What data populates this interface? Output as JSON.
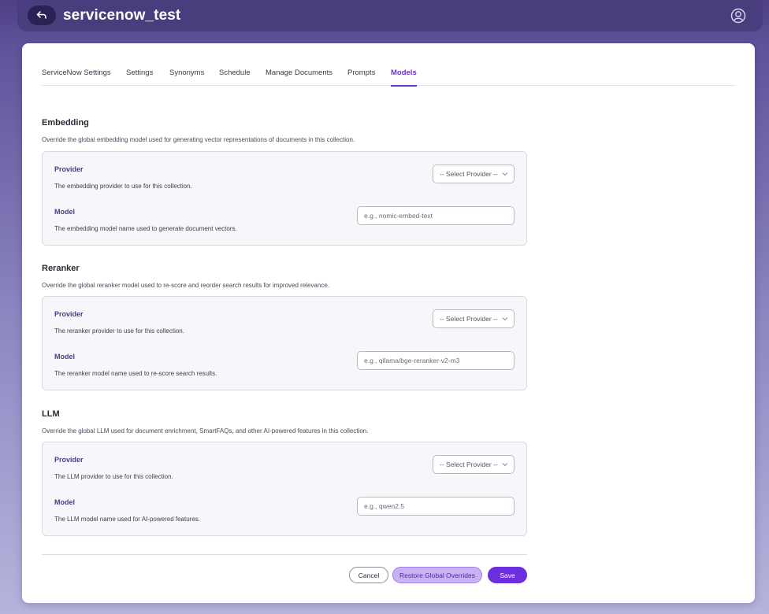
{
  "header": {
    "title": "servicenow_test",
    "back_icon": "back-arrow-icon",
    "user_icon": "user-circle-icon"
  },
  "tabs": [
    {
      "label": "ServiceNow Settings",
      "active": false
    },
    {
      "label": "Settings",
      "active": false
    },
    {
      "label": "Synonyms",
      "active": false
    },
    {
      "label": "Schedule",
      "active": false
    },
    {
      "label": "Manage Documents",
      "active": false
    },
    {
      "label": "Prompts",
      "active": false
    },
    {
      "label": "Models",
      "active": true
    }
  ],
  "sections": {
    "embedding": {
      "title": "Embedding",
      "description": "Override the global embedding model used for generating vector representations of documents in this collection.",
      "provider_label": "Provider",
      "provider_help": "The embedding provider to use for this collection.",
      "provider_value": "-- Select Provider --",
      "model_label": "Model",
      "model_help": "The embedding model name used to generate document vectors.",
      "model_placeholder": "e.g., nomic-embed-text"
    },
    "reranker": {
      "title": "Reranker",
      "description": "Override the global reranker model used to re-score and reorder search results for improved relevance.",
      "provider_label": "Provider",
      "provider_help": "The reranker provider to use for this collection.",
      "provider_value": "-- Select Provider --",
      "model_label": "Model",
      "model_help": "The reranker model name used to re-score search results.",
      "model_placeholder": "e.g., qllama/bge-reranker-v2-m3"
    },
    "llm": {
      "title": "LLM",
      "description": "Override the global LLM used for document enrichment, SmartFAQs, and other AI-powered features in this collection.",
      "provider_label": "Provider",
      "provider_help": "The LLM provider to use for this collection.",
      "provider_value": "-- Select Provider --",
      "model_label": "Model",
      "model_help": "The LLM model name used for AI-powered features.",
      "model_placeholder": "e.g., qwen2.5"
    }
  },
  "footer": {
    "cancel_label": "Cancel",
    "restore_label": "Restore Global Overrides",
    "save_label": "Save"
  },
  "colors": {
    "accent": "#6c2fe0",
    "header_bg": "#4a3d7e",
    "field_label": "#4d3d88"
  }
}
